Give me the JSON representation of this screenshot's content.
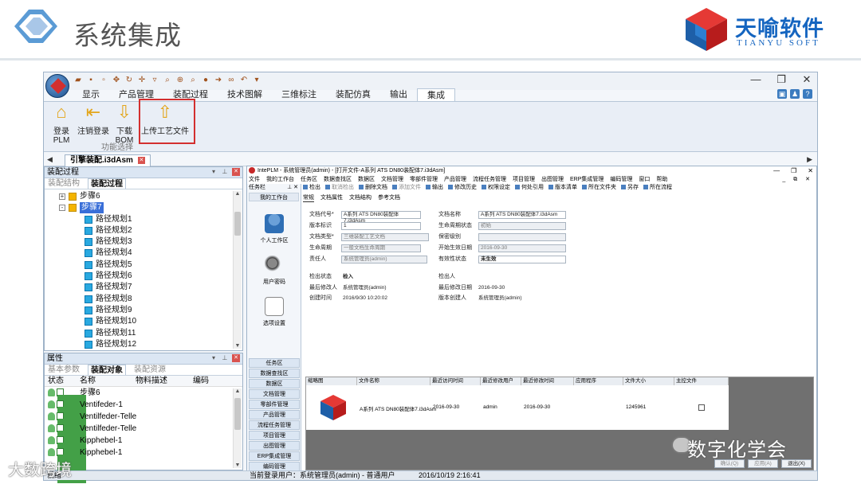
{
  "slide": {
    "title": "系统集成",
    "brand_name": "天喻软件",
    "brand_sub": "TIANYU SOFT"
  },
  "app": {
    "ribbon_tabs": [
      "显示",
      "产品管理",
      "装配过程",
      "技术图解",
      "三维标注",
      "装配仿真",
      "输出",
      "集成"
    ],
    "active_tab": "集成",
    "ribbon_buttons": [
      {
        "label": "登录PLM",
        "icon": "home-icon"
      },
      {
        "label": "注销登录",
        "icon": "logout-icon"
      },
      {
        "label": "下载BOM",
        "icon": "download-icon"
      },
      {
        "label": "上传工艺文件",
        "icon": "upload-icon"
      }
    ],
    "ribbon_group_label": "功能选择",
    "doc_tab": "引擎装配.i3dAsm",
    "status_text": "就绪"
  },
  "assembly_panel": {
    "title": "装配过程",
    "tabs": [
      "装配结构",
      "装配过程"
    ],
    "active_tab": "装配过程",
    "tree": [
      {
        "label": "步骤6",
        "level": 1,
        "expander": "+",
        "icon": "gold"
      },
      {
        "label": "步骤7",
        "level": 1,
        "expander": "-",
        "icon": "gold",
        "selected": true
      },
      {
        "label": "路径规划1",
        "level": 2,
        "icon": "blue"
      },
      {
        "label": "路径规划2",
        "level": 2,
        "icon": "blue"
      },
      {
        "label": "路径规划3",
        "level": 2,
        "icon": "blue"
      },
      {
        "label": "路径规划4",
        "level": 2,
        "icon": "blue"
      },
      {
        "label": "路径规划5",
        "level": 2,
        "icon": "blue"
      },
      {
        "label": "路径规划6",
        "level": 2,
        "icon": "blue"
      },
      {
        "label": "路径规划7",
        "level": 2,
        "icon": "blue"
      },
      {
        "label": "路径规划8",
        "level": 2,
        "icon": "blue"
      },
      {
        "label": "路径规划9",
        "level": 2,
        "icon": "blue"
      },
      {
        "label": "路径规划10",
        "level": 2,
        "icon": "blue"
      },
      {
        "label": "路径规划11",
        "level": 2,
        "icon": "blue"
      },
      {
        "label": "路径规划12",
        "level": 2,
        "icon": "blue"
      }
    ]
  },
  "props_panel": {
    "title": "属性",
    "tabs": [
      "基本参数",
      "装配对象",
      "装配资源"
    ],
    "active_tab": "装配对象",
    "columns": [
      "状态",
      "名称",
      "物料描述",
      "编码"
    ],
    "rows": [
      "步骤6",
      "Ventifeder-1",
      "Ventilfeder-Telle",
      "Ventilfeder-Telle",
      "Kipphebel-1",
      "Kipphebel-1"
    ]
  },
  "plm": {
    "window_title": "IntePLM - 系统管理员(admin) - [打开文件-A系列 ATS DN80装配体7.i3dAsm]",
    "menu": [
      "文件",
      "我的工作台",
      "任务区",
      "数据查找区",
      "数据区",
      "文档管理",
      "零部件管理",
      "产品管理",
      "流程任务管理",
      "项目管理",
      "出图管理",
      "ERP集成管理",
      "编码管理",
      "窗口",
      "帮助"
    ],
    "left_title": "任务栏",
    "left_sub": "我的工作台",
    "nav": [
      "个人工作区",
      "用户密码",
      "选项设置"
    ],
    "bottom_nav": [
      "任务区",
      "数据查找区",
      "数据区",
      "文档管理",
      "零部件管理",
      "产品管理",
      "流程任务管理",
      "项目管理",
      "出图管理",
      "ERP集成管理",
      "编码管理"
    ],
    "toolbar": [
      {
        "label": "检出",
        "dim": false
      },
      {
        "label": "取消检出",
        "dim": true
      },
      {
        "label": "删除文档",
        "dim": false
      },
      {
        "label": "添加文件",
        "dim": true
      },
      {
        "label": "输出",
        "dim": false
      },
      {
        "label": "修改历史",
        "dim": false
      },
      {
        "label": "权限设定",
        "dim": false
      },
      {
        "label": "何处引用",
        "dim": false
      },
      {
        "label": "版本清单",
        "dim": false
      },
      {
        "label": "所在文件夹",
        "dim": false
      },
      {
        "label": "另存",
        "dim": false
      },
      {
        "label": "所在流程",
        "dim": false
      }
    ],
    "tabs": [
      "常规",
      "文档属性",
      "文档结构",
      "参考文档"
    ],
    "active_tab": "常规",
    "form": {
      "doc_code_label": "文档代号*",
      "doc_code": "A系列 ATS DN80装配体7.i3dAsm",
      "doc_name_label": "文档名称",
      "doc_name": "A系列 ATS DN80装配体7.i3dAsm",
      "version_label": "版本标识",
      "version": "1",
      "lifecycle_state_label": "生命周期状态",
      "lifecycle_state": "初始",
      "doc_type_label": "文档类型*",
      "doc_type": "三维装配工艺文档",
      "secret_label": "保密级别",
      "secret": "",
      "lifecycle_label": "生命周期",
      "lifecycle": "一般文档生命周期",
      "start_date_label": "开始生效日期",
      "start_date": "2016-09-30",
      "owner_label": "责任人",
      "owner": "系统管理员(admin)",
      "valid_state_label": "有效性状态",
      "valid_state": "未生效",
      "checkout_state_label": "检出状态",
      "checkout_state": "检入",
      "checkout_user_label": "检出人",
      "checkout_user": "",
      "last_modifier_label": "最后修改人",
      "last_modifier": "系统管理员(admin)",
      "last_modified_date_label": "最后修改日期",
      "last_modified_date": "2016-09-30",
      "created_time_label": "创建时间",
      "created_time": "2016/9/30 10:20:02",
      "version_creator_label": "版本创建人",
      "version_creator": "系统管理员(admin)"
    },
    "grid": {
      "columns": [
        "缩略图",
        "文件名称",
        "最近访问时间",
        "最近修改用户",
        "最近修改时间",
        "应用程序",
        "文件大小",
        "主控文件"
      ],
      "row": {
        "file_name": "A系列 ATS DN80装配体7.i3dAsm",
        "last_access": "2016-09-30",
        "last_user": "admin",
        "last_modified": "2016-09-30",
        "app": "",
        "size": "1245961"
      }
    },
    "footer_buttons": [
      {
        "label": "确认(Q)",
        "enabled": false
      },
      {
        "label": "应用(A)",
        "enabled": false
      },
      {
        "label": "退出(X)",
        "enabled": true
      }
    ],
    "status_user": "当前登录用户：系统管理员(admin) - 普通用户",
    "status_time": "2016/10/19 2:16:41"
  },
  "watermark": {
    "right": "数字化学会",
    "left": "大数跨境"
  },
  "colors": {
    "accent": "#1565c0",
    "highlight": "#d32f2f",
    "selection": "#3a6fd8"
  }
}
